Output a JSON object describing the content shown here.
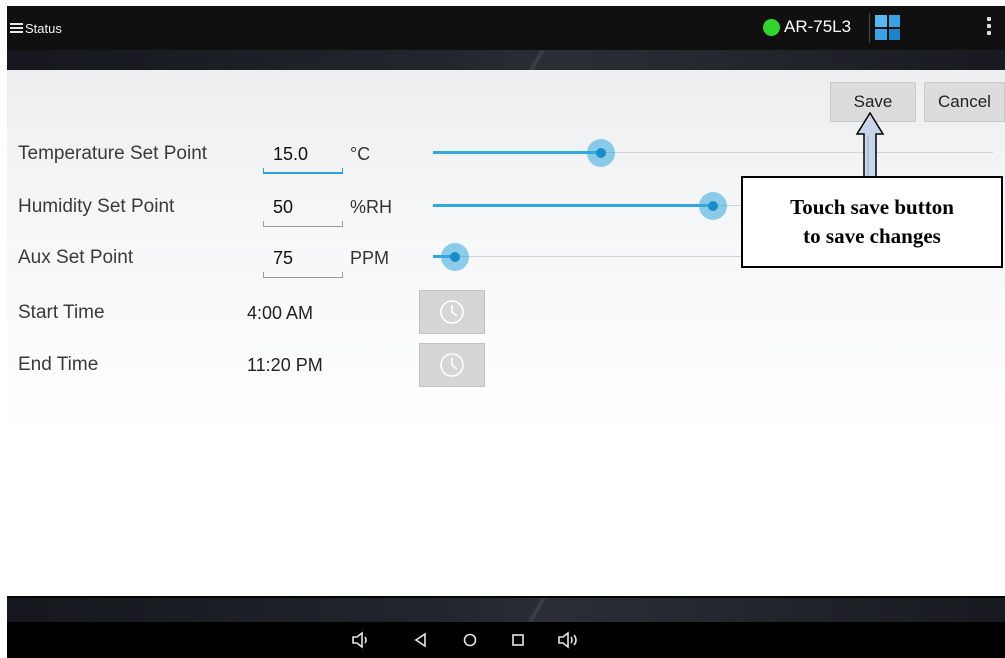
{
  "topbar": {
    "menu_label": "Status",
    "device_name": "AR-75L3",
    "connection_color": "#32d42e"
  },
  "actions": {
    "save_label": "Save",
    "cancel_label": "Cancel"
  },
  "setpoints": [
    {
      "label": "Temperature Set Point",
      "value": "15.0",
      "unit": "°C",
      "slider_fraction": 0.3
    },
    {
      "label": "Humidity Set Point",
      "value": "50",
      "unit": "%RH",
      "slider_fraction": 0.5
    },
    {
      "label": "Aux Set Point",
      "value": "75",
      "unit": "PPM",
      "slider_fraction": 0.04
    }
  ],
  "times": [
    {
      "label": "Start Time",
      "value": "4:00 AM"
    },
    {
      "label": "End Time",
      "value": "11:20 PM"
    }
  ],
  "callout": {
    "line1": "Touch save button",
    "line2": "to save changes"
  },
  "navbar": {
    "icons": [
      "volume-down-icon",
      "back-icon",
      "home-icon",
      "recents-icon",
      "volume-up-icon"
    ]
  },
  "colors": {
    "accent": "#33a8e0",
    "topbar_bg": "#101010"
  }
}
